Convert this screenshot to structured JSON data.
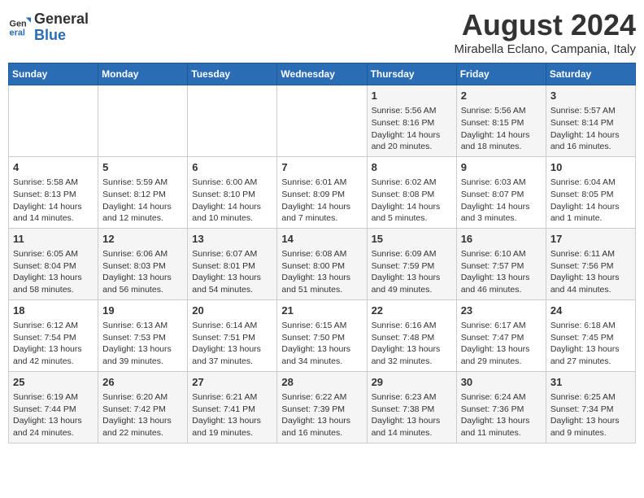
{
  "header": {
    "logo_line1": "General",
    "logo_line2": "Blue",
    "month_title": "August 2024",
    "location": "Mirabella Eclano, Campania, Italy"
  },
  "days_of_week": [
    "Sunday",
    "Monday",
    "Tuesday",
    "Wednesday",
    "Thursday",
    "Friday",
    "Saturday"
  ],
  "weeks": [
    [
      {
        "day": "",
        "info": ""
      },
      {
        "day": "",
        "info": ""
      },
      {
        "day": "",
        "info": ""
      },
      {
        "day": "",
        "info": ""
      },
      {
        "day": "1",
        "info": "Sunrise: 5:56 AM\nSunset: 8:16 PM\nDaylight: 14 hours and 20 minutes."
      },
      {
        "day": "2",
        "info": "Sunrise: 5:56 AM\nSunset: 8:15 PM\nDaylight: 14 hours and 18 minutes."
      },
      {
        "day": "3",
        "info": "Sunrise: 5:57 AM\nSunset: 8:14 PM\nDaylight: 14 hours and 16 minutes."
      }
    ],
    [
      {
        "day": "4",
        "info": "Sunrise: 5:58 AM\nSunset: 8:13 PM\nDaylight: 14 hours and 14 minutes."
      },
      {
        "day": "5",
        "info": "Sunrise: 5:59 AM\nSunset: 8:12 PM\nDaylight: 14 hours and 12 minutes."
      },
      {
        "day": "6",
        "info": "Sunrise: 6:00 AM\nSunset: 8:10 PM\nDaylight: 14 hours and 10 minutes."
      },
      {
        "day": "7",
        "info": "Sunrise: 6:01 AM\nSunset: 8:09 PM\nDaylight: 14 hours and 7 minutes."
      },
      {
        "day": "8",
        "info": "Sunrise: 6:02 AM\nSunset: 8:08 PM\nDaylight: 14 hours and 5 minutes."
      },
      {
        "day": "9",
        "info": "Sunrise: 6:03 AM\nSunset: 8:07 PM\nDaylight: 14 hours and 3 minutes."
      },
      {
        "day": "10",
        "info": "Sunrise: 6:04 AM\nSunset: 8:05 PM\nDaylight: 14 hours and 1 minute."
      }
    ],
    [
      {
        "day": "11",
        "info": "Sunrise: 6:05 AM\nSunset: 8:04 PM\nDaylight: 13 hours and 58 minutes."
      },
      {
        "day": "12",
        "info": "Sunrise: 6:06 AM\nSunset: 8:03 PM\nDaylight: 13 hours and 56 minutes."
      },
      {
        "day": "13",
        "info": "Sunrise: 6:07 AM\nSunset: 8:01 PM\nDaylight: 13 hours and 54 minutes."
      },
      {
        "day": "14",
        "info": "Sunrise: 6:08 AM\nSunset: 8:00 PM\nDaylight: 13 hours and 51 minutes."
      },
      {
        "day": "15",
        "info": "Sunrise: 6:09 AM\nSunset: 7:59 PM\nDaylight: 13 hours and 49 minutes."
      },
      {
        "day": "16",
        "info": "Sunrise: 6:10 AM\nSunset: 7:57 PM\nDaylight: 13 hours and 46 minutes."
      },
      {
        "day": "17",
        "info": "Sunrise: 6:11 AM\nSunset: 7:56 PM\nDaylight: 13 hours and 44 minutes."
      }
    ],
    [
      {
        "day": "18",
        "info": "Sunrise: 6:12 AM\nSunset: 7:54 PM\nDaylight: 13 hours and 42 minutes."
      },
      {
        "day": "19",
        "info": "Sunrise: 6:13 AM\nSunset: 7:53 PM\nDaylight: 13 hours and 39 minutes."
      },
      {
        "day": "20",
        "info": "Sunrise: 6:14 AM\nSunset: 7:51 PM\nDaylight: 13 hours and 37 minutes."
      },
      {
        "day": "21",
        "info": "Sunrise: 6:15 AM\nSunset: 7:50 PM\nDaylight: 13 hours and 34 minutes."
      },
      {
        "day": "22",
        "info": "Sunrise: 6:16 AM\nSunset: 7:48 PM\nDaylight: 13 hours and 32 minutes."
      },
      {
        "day": "23",
        "info": "Sunrise: 6:17 AM\nSunset: 7:47 PM\nDaylight: 13 hours and 29 minutes."
      },
      {
        "day": "24",
        "info": "Sunrise: 6:18 AM\nSunset: 7:45 PM\nDaylight: 13 hours and 27 minutes."
      }
    ],
    [
      {
        "day": "25",
        "info": "Sunrise: 6:19 AM\nSunset: 7:44 PM\nDaylight: 13 hours and 24 minutes."
      },
      {
        "day": "26",
        "info": "Sunrise: 6:20 AM\nSunset: 7:42 PM\nDaylight: 13 hours and 22 minutes."
      },
      {
        "day": "27",
        "info": "Sunrise: 6:21 AM\nSunset: 7:41 PM\nDaylight: 13 hours and 19 minutes."
      },
      {
        "day": "28",
        "info": "Sunrise: 6:22 AM\nSunset: 7:39 PM\nDaylight: 13 hours and 16 minutes."
      },
      {
        "day": "29",
        "info": "Sunrise: 6:23 AM\nSunset: 7:38 PM\nDaylight: 13 hours and 14 minutes."
      },
      {
        "day": "30",
        "info": "Sunrise: 6:24 AM\nSunset: 7:36 PM\nDaylight: 13 hours and 11 minutes."
      },
      {
        "day": "31",
        "info": "Sunrise: 6:25 AM\nSunset: 7:34 PM\nDaylight: 13 hours and 9 minutes."
      }
    ]
  ]
}
